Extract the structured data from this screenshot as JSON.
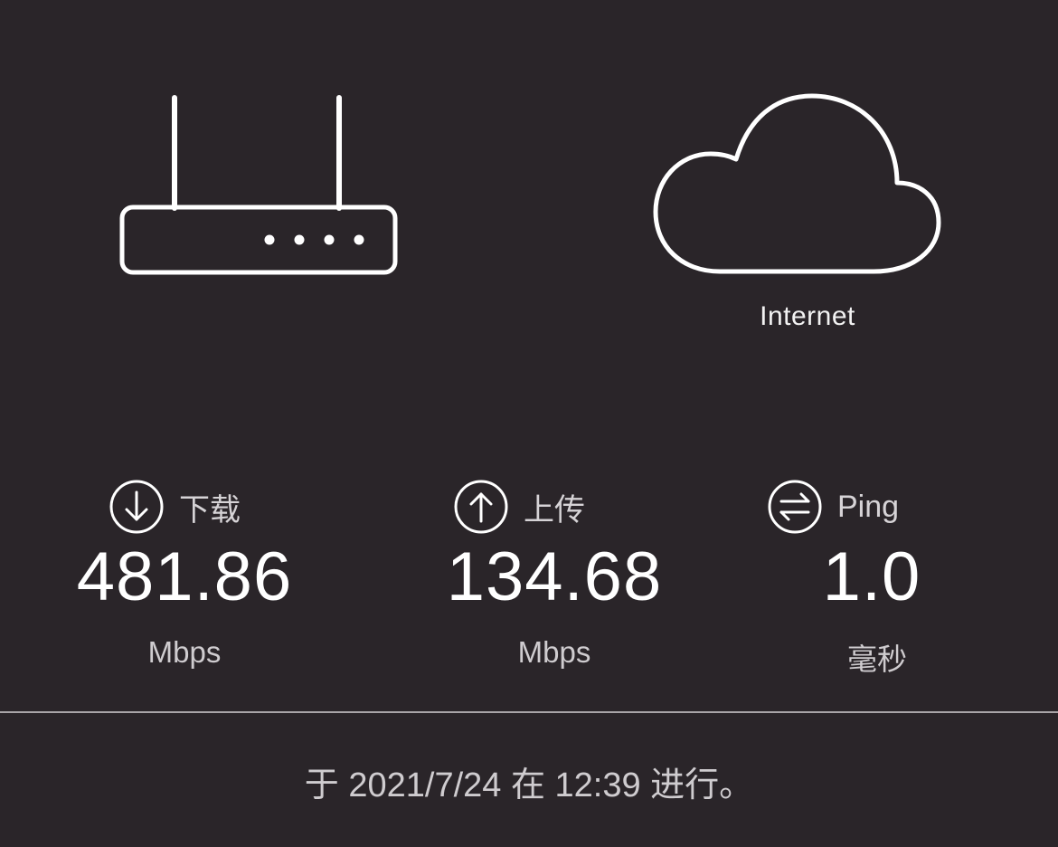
{
  "topology": {
    "router_icon": "wifi-router-icon",
    "cloud_icon": "cloud-icon",
    "internet_label": "Internet"
  },
  "metrics": {
    "download": {
      "icon": "arrow-down-circle-icon",
      "label": "下载",
      "value": "481.86",
      "unit": "Mbps"
    },
    "upload": {
      "icon": "arrow-up-circle-icon",
      "label": "上传",
      "value": "134.68",
      "unit": "Mbps"
    },
    "ping": {
      "icon": "swap-arrows-circle-icon",
      "label": "Ping",
      "value": "1.0",
      "unit": "毫秒"
    }
  },
  "footer": {
    "text": "于 2021/7/24 在 12:39 进行。"
  },
  "colors": {
    "background": "#2a2529",
    "foreground": "#ffffff",
    "muted": "#cfcccf",
    "divider": "#a9a5a8"
  }
}
